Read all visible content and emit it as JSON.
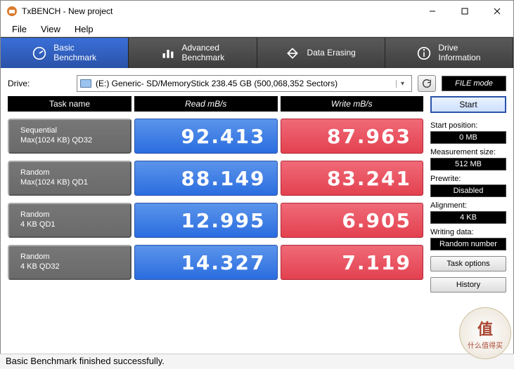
{
  "window": {
    "title": "TxBENCH - New project"
  },
  "menu": {
    "file": "File",
    "view": "View",
    "help": "Help"
  },
  "tabs": {
    "basic": "Basic\nBenchmark",
    "advanced": "Advanced\nBenchmark",
    "erasing": "Data Erasing",
    "drive": "Drive\nInformation"
  },
  "drive": {
    "label": "Drive:",
    "value": "(E:) Generic- SD/MemoryStick  238.45 GB (500,068,352 Sectors)"
  },
  "filemode": "FILE mode",
  "headers": {
    "task": "Task name",
    "read": "Read mB/s",
    "write": "Write mB/s"
  },
  "rows": [
    {
      "name1": "Sequential",
      "name2": "Max(1024 KB) QD32",
      "read": "92.413",
      "write": "87.963"
    },
    {
      "name1": "Random",
      "name2": "Max(1024 KB) QD1",
      "read": "88.149",
      "write": "83.241"
    },
    {
      "name1": "Random",
      "name2": "4 KB QD1",
      "read": "12.995",
      "write": "6.905"
    },
    {
      "name1": "Random",
      "name2": "4 KB QD32",
      "read": "14.327",
      "write": "7.119"
    }
  ],
  "side": {
    "start": "Start",
    "startpos_l": "Start position:",
    "startpos_v": "0 MB",
    "msize_l": "Measurement size:",
    "msize_v": "512 MB",
    "prewrite_l": "Prewrite:",
    "prewrite_v": "Disabled",
    "align_l": "Alignment:",
    "align_v": "4 KB",
    "wdata_l": "Writing data:",
    "wdata_v": "Random number",
    "taskopt": "Task options",
    "history": "History"
  },
  "status": "Basic Benchmark finished successfully.",
  "watermark": {
    "big": "值",
    "small": "什么值得买"
  }
}
